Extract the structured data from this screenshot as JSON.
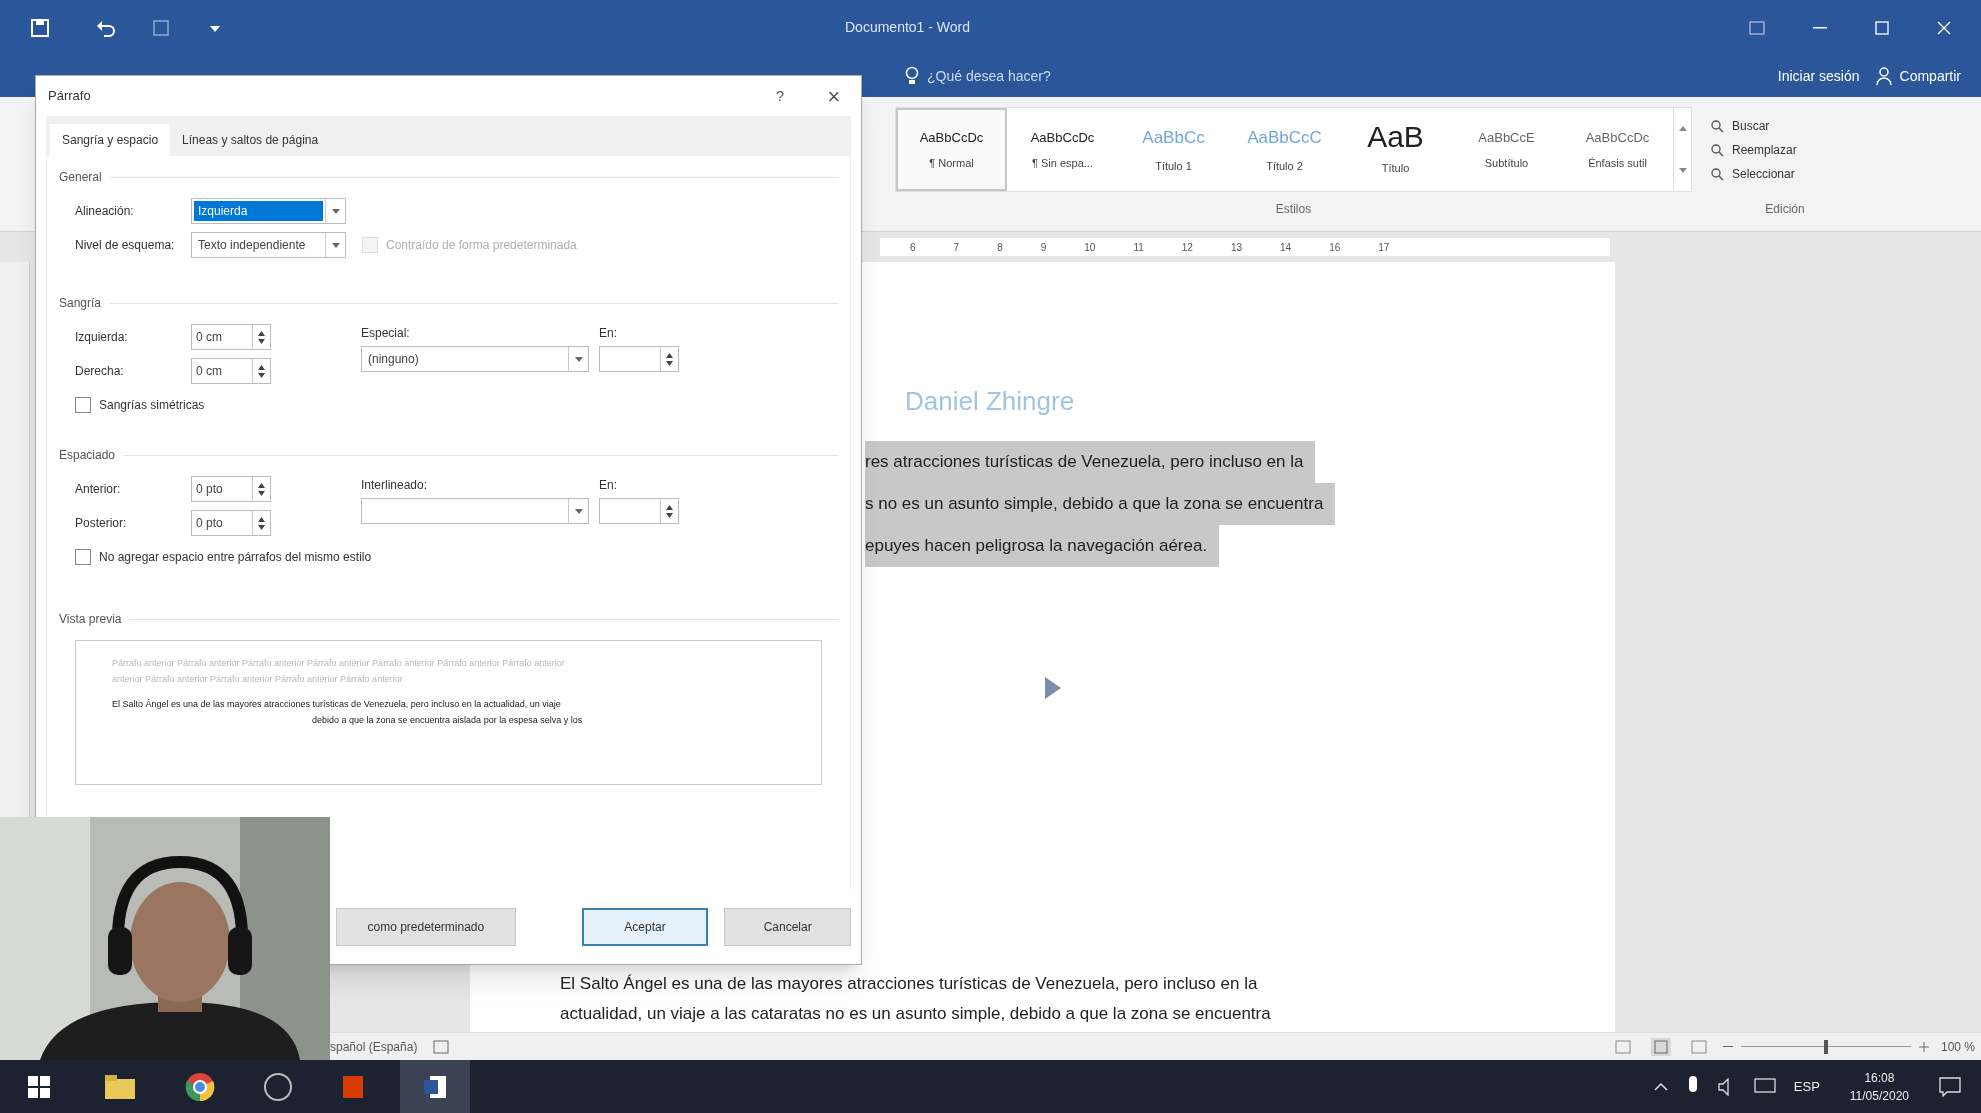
{
  "window": {
    "title": "Documento1 - Word",
    "tell_me": "¿Qué desea hacer?",
    "sign_in": "Iniciar sesión",
    "share": "Compartir"
  },
  "ribbon": {
    "styles": [
      {
        "sample": "AaBbCcDc",
        "label": "¶ Normal",
        "selected": true,
        "kind": "body"
      },
      {
        "sample": "AaBbCcDc",
        "label": "¶ Sin espa...",
        "selected": false,
        "kind": "body"
      },
      {
        "sample": "AaBbCc",
        "label": "Título 1",
        "selected": false,
        "kind": "heading"
      },
      {
        "sample": "AaBbCcC",
        "label": "Título 2",
        "selected": false,
        "kind": "heading"
      },
      {
        "sample": "AaB",
        "label": "Título",
        "selected": false,
        "kind": "title"
      },
      {
        "sample": "AaBbCcE",
        "label": "Subtítulo",
        "selected": false,
        "kind": "subtle"
      },
      {
        "sample": "AaBbCcDc",
        "label": "Énfasis sutil",
        "selected": false,
        "kind": "subtle"
      }
    ],
    "styles_group": "Estilos",
    "editing": [
      "Buscar",
      "Reemplazar",
      "Seleccionar"
    ],
    "editing_group": "Edición"
  },
  "ruler": [
    "6",
    "7",
    "8",
    "9",
    "10",
    "11",
    "12",
    "13",
    "14",
    "16",
    "17"
  ],
  "document": {
    "author": "Daniel Zhingre",
    "selected_lines": [
      "res atracciones turísticas de Venezuela, pero incluso en la",
      "s no es un asunto simple, debido a que la zona se encuentra",
      "epuyes hacen peligrosa la navegación aérea."
    ],
    "lines": [
      "El Salto Ángel es una de las mayores atracciones turísticas de Venezuela, pero incluso en la",
      "actualidad, un viaje a las cataratas no es un asunto simple, debido a que la zona se encuentra"
    ]
  },
  "dialog": {
    "title": "Párrafo",
    "help": "?",
    "close": "×",
    "tabs": [
      {
        "label": "Sangría y espacio",
        "selected": true
      },
      {
        "label": "Líneas y saltos de página",
        "selected": false
      }
    ],
    "general": {
      "heading": "General",
      "alignment_label": "Alineación:",
      "alignment": "Izquierda",
      "outline_label": "Nivel de esquema:",
      "outline": "Texto independiente",
      "collapsed": {
        "label": "Contraído de forma predeterminada",
        "checked": false,
        "disabled": true
      }
    },
    "indent": {
      "heading": "Sangría",
      "left_label": "Izquierda:",
      "left": "0 cm",
      "right_label": "Derecha:",
      "right": "0 cm",
      "special_label": "Especial:",
      "special": "(ninguno)",
      "by_label": "En:",
      "mirror": {
        "label": "Sangrías simétricas",
        "checked": false,
        "disabled": false
      }
    },
    "spacing": {
      "heading": "Espaciado",
      "before_label": "Anterior:",
      "before": "0 pto",
      "after_label": "Posterior:",
      "after": "0 pto",
      "line_label": "Interlineado:",
      "at_label": "En:",
      "no_space": {
        "label": "No agregar espacio entre párrafos del mismo estilo",
        "checked": false,
        "disabled": false
      }
    },
    "preview": {
      "heading": "Vista previa",
      "previous": [
        "Párrafo anterior Párrafo anterior Párrafo anterior Párrafo anterior Párrafo anterior Párrafo anterior Párrafo anterior",
        "anterior Párrafo anterior Párrafo anterior Párrafo anterior Párrafo anterior"
      ],
      "sample": [
        "El Salto Ángel es una de las mayores atracciones turísticas de Venezuela, pero incluso en la actualidad, un viaje",
        "debido a que la zona se encuentra aislada por la espesa selva y los"
      ]
    },
    "buttons": [
      {
        "label": "como predeterminado",
        "kind": "plain"
      },
      {
        "label": "Aceptar",
        "kind": "default"
      },
      {
        "label": "Cancelar",
        "kind": "plain"
      }
    ]
  },
  "status_bar": {
    "language": "spañol (España)",
    "zoom": "100 %",
    "zoom_slider": {
      "level": 0.5
    }
  },
  "taskbar": {
    "language": "ESP",
    "time": "16:08",
    "date": "11/05/2020"
  }
}
